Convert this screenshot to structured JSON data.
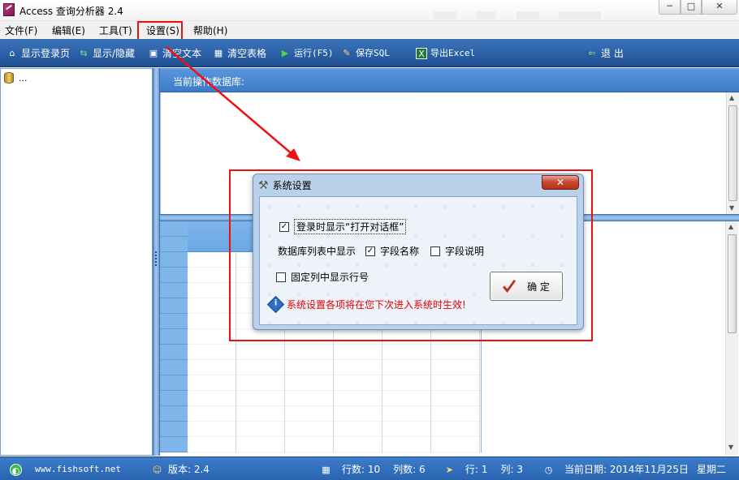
{
  "window": {
    "title": "Access 查询分析器 2.4",
    "min": "─",
    "max": "□",
    "close": "✕"
  },
  "menu": [
    "文件(F)",
    "编辑(E)",
    "工具(T)",
    "设置(S)",
    "帮助(H)"
  ],
  "toolbar": {
    "show_login": "显示登录页",
    "show_hide": "显示/隐藏",
    "clear_text": "清空文本",
    "clear_table": "清空表格",
    "run": "运行(F5)",
    "save_sql": "保存SQL",
    "export_excel": "导出Excel",
    "exit": "退 出"
  },
  "tree": {
    "root_label": "..."
  },
  "sql_panel": {
    "header": "当前操作数据库:"
  },
  "dialog": {
    "title": "系统设置",
    "close": "✕",
    "opt_open_dialog": "登录时显示“打开对话框”",
    "opt_open_dialog_checked": true,
    "list_display_label": "数据库列表中显示",
    "opt_field_name": "字段名称",
    "opt_field_name_checked": true,
    "opt_field_desc": "字段说明",
    "opt_field_desc_checked": false,
    "opt_row_number": "固定列中显示行号",
    "opt_row_number_checked": false,
    "ok_label": "确  定",
    "notice": "系统设置各项将在您下次进入系统时生效!"
  },
  "status": {
    "website": "www.fishsoft.net",
    "version": "版本: 2.4",
    "rows": "行数: 10",
    "cols": "列数: 6",
    "row": "行: 1",
    "col": "列: 3",
    "date": "当前日期: 2014年11月25日",
    "weekday": "星期二"
  },
  "colors": {
    "toolbar": "#2d62a8",
    "highlight": "#ee1111",
    "notice": "#e00000",
    "grid_header": "#7fb6ea"
  }
}
